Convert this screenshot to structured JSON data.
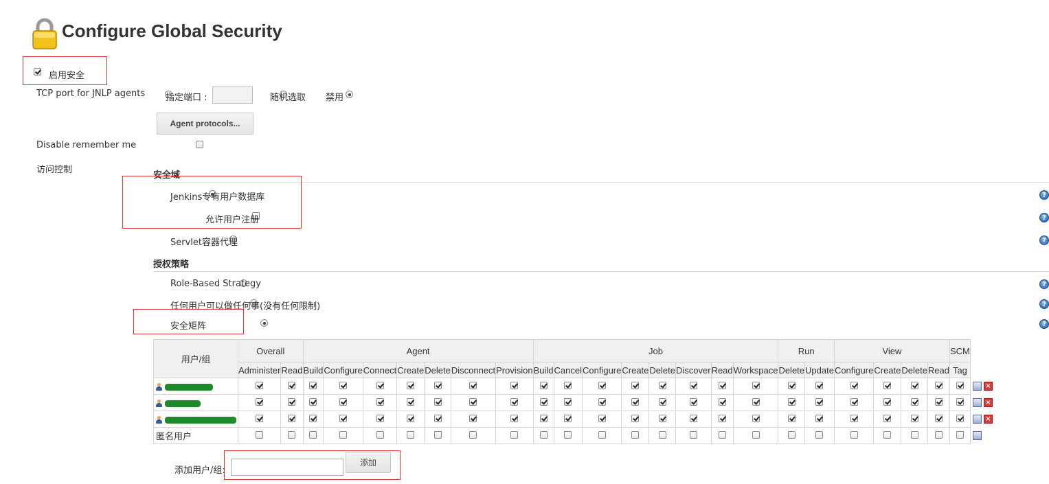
{
  "page": {
    "title": "Configure Global Security"
  },
  "enable_security": {
    "label": "启用安全",
    "checked": true
  },
  "jnlp": {
    "label": "TCP port for JNLP agents",
    "options": [
      {
        "label": "指定端口 :",
        "selected": false
      },
      {
        "label": "随机选取",
        "selected": false
      },
      {
        "label": "禁用",
        "selected": true
      }
    ],
    "port_value": "",
    "agent_protocols_button": "Agent protocols..."
  },
  "disable_remember_me": {
    "label": "Disable remember me",
    "checked": false
  },
  "access_control": {
    "label": "访问控制",
    "security_realm": {
      "heading": "安全域",
      "jenkins_db": {
        "label": "Jenkins专有用户数据库",
        "selected": true
      },
      "allow_signup": {
        "label": "允许用户注册",
        "checked": false
      },
      "servlet": {
        "label": "Servlet容器代理",
        "selected": false
      }
    },
    "authorization": {
      "heading": "授权策略",
      "role_based": {
        "label": "Role-Based Strategy",
        "selected": false
      },
      "anyone": {
        "label": "任何用户可以做任何事(没有任何限制)",
        "selected": false
      },
      "matrix": {
        "label": "安全矩阵",
        "selected": true
      }
    }
  },
  "matrix_table": {
    "user_header": "用户/组",
    "groups": [
      {
        "name": "Overall",
        "perms": [
          "Administer",
          "Read"
        ]
      },
      {
        "name": "Agent",
        "perms": [
          "Build",
          "Configure",
          "Connect",
          "Create",
          "Delete",
          "Disconnect",
          "Provision"
        ]
      },
      {
        "name": "Job",
        "perms": [
          "Build",
          "Cancel",
          "Configure",
          "Create",
          "Delete",
          "Discover",
          "Read",
          "Workspace"
        ]
      },
      {
        "name": "Run",
        "perms": [
          "Delete",
          "Update"
        ]
      },
      {
        "name": "View",
        "perms": [
          "Configure",
          "Create",
          "Delete",
          "Read"
        ]
      },
      {
        "name": "SCM",
        "perms": [
          "Tag"
        ]
      }
    ],
    "rows": [
      {
        "user": "",
        "redacted": true,
        "all_checked": true,
        "deletable": true
      },
      {
        "user": "",
        "redacted": true,
        "all_checked": true,
        "deletable": true
      },
      {
        "user": "",
        "redacted": true,
        "all_checked": true,
        "deletable": true
      },
      {
        "user": "匿名用户",
        "redacted": false,
        "all_checked": false,
        "deletable": false
      }
    ]
  },
  "add_user": {
    "label": "添加用户/组:",
    "value": "",
    "button": "添加"
  },
  "colors": {
    "highlight_box": "#e03030",
    "help_icon": "#1f5fa8",
    "title": "#333333"
  },
  "icons": {
    "title": "lock-icon",
    "help": "help-icon",
    "user": "user-icon",
    "edit": "edit-icon",
    "delete": "delete-icon"
  }
}
